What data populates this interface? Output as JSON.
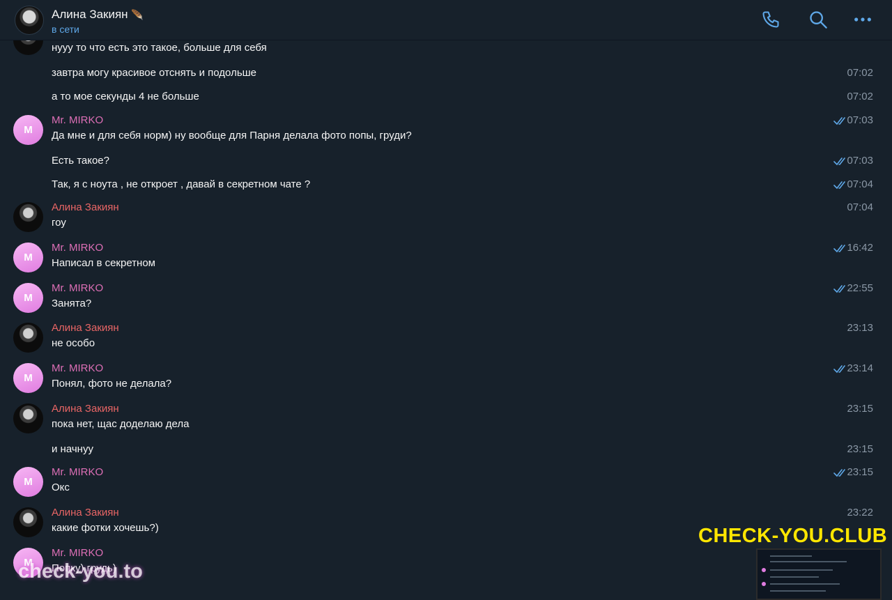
{
  "header": {
    "name": "Алина Закиян",
    "name_emoji": "🪶",
    "status": "в сети"
  },
  "icons": {
    "call": "phone-icon",
    "search": "search-icon",
    "more": "more-dots-icon"
  },
  "colors": {
    "background": "#17212b",
    "accent": "#5fa8e8",
    "mirko": "#dd6fb6",
    "alina": "#e86565",
    "time": "#8a97a5"
  },
  "messages": [
    {
      "sender": "",
      "avatar": "a",
      "text": "нууу то что есть это такое, больше для себя",
      "time": "",
      "read": false
    },
    {
      "sender": "",
      "avatar": "",
      "text": "завтра могу красивое отснять и подольше",
      "time": "07:02",
      "read": false
    },
    {
      "sender": "",
      "avatar": "",
      "text": "а то мое секунды 4 не больше",
      "time": "07:02",
      "read": false
    },
    {
      "sender": "Mr. MIRKO",
      "avatar": "M",
      "text": "Да мне и для себя норм) ну вообще для Парня делала фото попы, груди?",
      "time": "07:03",
      "read": true
    },
    {
      "sender": "",
      "avatar": "",
      "text": "Есть такое?",
      "time": "07:03",
      "read": true
    },
    {
      "sender": "",
      "avatar": "",
      "text": "Так, я с ноута , не откроет , давай в секретном чате ?",
      "time": "07:04",
      "read": true
    },
    {
      "sender": "Алина Закиян",
      "avatar": "a",
      "text": "гоу",
      "time": "07:04",
      "read": false
    },
    {
      "sender": "Mr. MIRKO",
      "avatar": "M",
      "text": "Написал в секретном",
      "time": "16:42",
      "read": true
    },
    {
      "sender": "Mr. MIRKO",
      "avatar": "M",
      "text": "Занята?",
      "time": "22:55",
      "read": true
    },
    {
      "sender": "Алина Закиян",
      "avatar": "a",
      "text": "не особо",
      "time": "23:13",
      "read": false
    },
    {
      "sender": "Mr. MIRKO",
      "avatar": "M",
      "text": "Понял, фото не делала?",
      "time": "23:14",
      "read": true
    },
    {
      "sender": "Алина Закиян",
      "avatar": "a",
      "text": "пока нет, щас доделаю дела",
      "time": "23:15",
      "read": false
    },
    {
      "sender": "",
      "avatar": "",
      "text": "и начнуу",
      "time": "23:15",
      "read": false
    },
    {
      "sender": "Mr. MIRKO",
      "avatar": "M",
      "text": "Окс",
      "time": "23:15",
      "read": true
    },
    {
      "sender": "Алина Закиян",
      "avatar": "a",
      "text": "какие фотки хочешь?)",
      "time": "23:22",
      "read": false
    },
    {
      "sender": "Mr. MIRKO",
      "avatar": "M",
      "text": "Попку) грудь)",
      "time": "",
      "read": false
    }
  ],
  "watermarks": {
    "main": "CHECK-YOU.CLUB",
    "secondary": "check-you.to"
  }
}
